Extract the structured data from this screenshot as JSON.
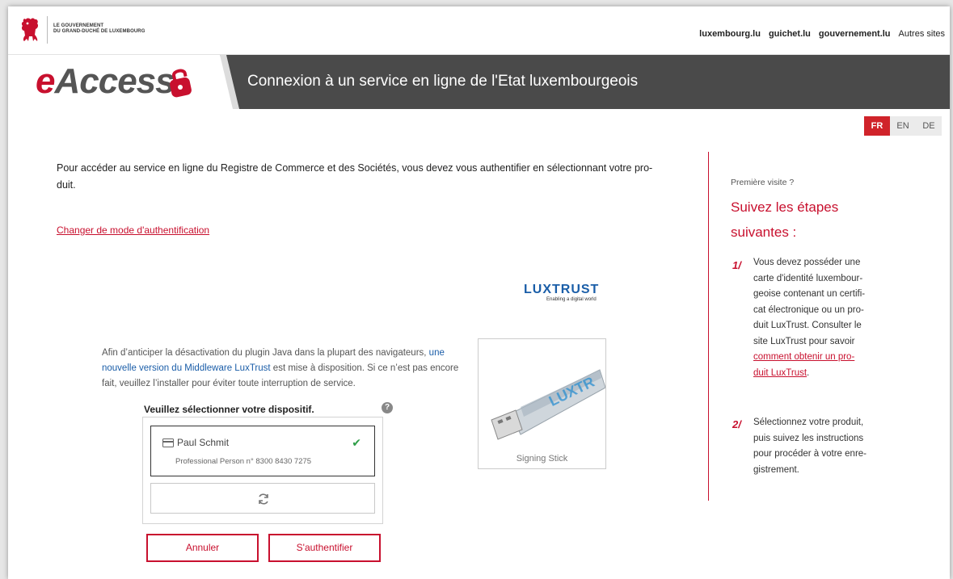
{
  "header": {
    "gov_line1": "LE GOUVERNEMENT",
    "gov_line2": "DU GRAND-DUCHÉ DE LUXEMBOURG",
    "links": [
      "luxembourg.lu",
      "guichet.lu",
      "gouvernement.lu",
      "Autres sites"
    ]
  },
  "banner": {
    "brand_prefix": "e",
    "brand_suffix": "Access",
    "title": "Connexion à un service en ligne de l'Etat luxembourgeois"
  },
  "languages": [
    {
      "code": "FR",
      "active": true
    },
    {
      "code": "EN",
      "active": false
    },
    {
      "code": "DE",
      "active": false
    }
  ],
  "main": {
    "intro_line1": "Pour accéder au service en ligne du Registre de Commerce et des Sociétés, vous devez vous authentifier en sélectionnant votre pro-",
    "intro_line2": "duit.",
    "change_link": "Changer de mode d'authentification",
    "luxtrust_logo": "LUXTRUST",
    "luxtrust_tagline": "Enabling a digital world",
    "notice_pre": "Afin d’anticiper la désactivation du plugin Java dans la plupart des navigateurs, ",
    "notice_link1": "une",
    "notice_link2": "nouvelle version du Middleware LuxTrust",
    "notice_post1": " est mise à disposition. Si ce n’est pas encore",
    "notice_post2": "fait, veuillez l’installer pour éviter toute interruption de service.",
    "select_title": "Veuillez sélectionner votre dispositif.",
    "device": {
      "name": "Paul Schmit",
      "detail": "Professional Person n° 8300 8430 7275"
    },
    "cancel_label": "Annuler",
    "auth_label": "S'authentifier",
    "stick_label": "Signing Stick"
  },
  "sidebar": {
    "first_visit": "Première visite ?",
    "steps_title_line1": "Suivez les étapes",
    "steps_title_line2": "suivantes :",
    "step1_num": "1/",
    "step1_l1": "Vous devez posséder une",
    "step1_l2": "carte d'identité luxembour-",
    "step1_l3": "geoise contenant un certifi-",
    "step1_l4": "cat électronique ou un pro-",
    "step1_l5": "duit LuxTrust. Consulter le",
    "step1_l6": "site LuxTrust pour savoir",
    "step1_link1": "comment obtenir un pro-",
    "step1_link2": "duit LuxTrust",
    "step1_end": ".",
    "step2_num": "2/",
    "step2_l1": "Sélectionnez votre produit,",
    "step2_l2": "puis suivez les instructions",
    "step2_l3": "pour procéder à votre enre-",
    "step2_l4": "gistrement."
  },
  "colors": {
    "accent": "#c8102e",
    "banner": "#4a4a4a",
    "check": "#2e9e47"
  }
}
